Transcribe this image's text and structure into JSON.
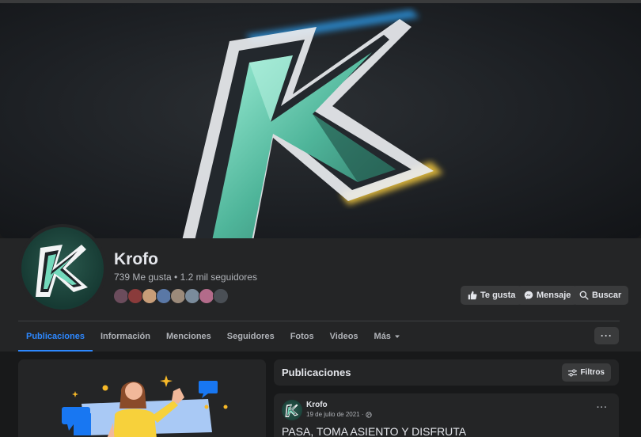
{
  "page": {
    "name": "Krofo",
    "stats": "739 Me gusta • 1.2 mil seguidores"
  },
  "actions": {
    "like_label": "Te gusta",
    "message_label": "Mensaje",
    "search_label": "Buscar"
  },
  "tabs": [
    {
      "label": "Publicaciones",
      "active": true
    },
    {
      "label": "Información"
    },
    {
      "label": "Menciones"
    },
    {
      "label": "Seguidores"
    },
    {
      "label": "Fotos"
    },
    {
      "label": "Videos"
    },
    {
      "label": "Más"
    }
  ],
  "more_button": "···",
  "publications": {
    "title": "Publicaciones",
    "filters_label": "Filtros"
  },
  "post": {
    "author": "Krofo",
    "date": "19 de julio de 2021 ·",
    "text": "PASA, TOMA ASIENTO Y DISFRUTA",
    "menu": "···"
  },
  "friend_avatars": [
    "#6b4c5c",
    "#8a3b3b",
    "#c79d78",
    "#5a78a6",
    "#9b8a7a",
    "#7a8b9b",
    "#b36b8a",
    "#4a4f55"
  ],
  "colors": {
    "accent": "#2d88ff",
    "background": "#18191a",
    "card": "#242526",
    "button": "#3a3b3c",
    "logo_teal": "#7fe0c4",
    "logo_glow_blue": "#2fa8ff",
    "logo_glow_yellow": "#ffd23f"
  },
  "icons": {
    "like": "thumbs-up-icon",
    "message": "messenger-icon",
    "search": "search-icon",
    "filters": "sliders-icon",
    "audience": "globe-icon",
    "dropdown": "caret-down-icon"
  }
}
